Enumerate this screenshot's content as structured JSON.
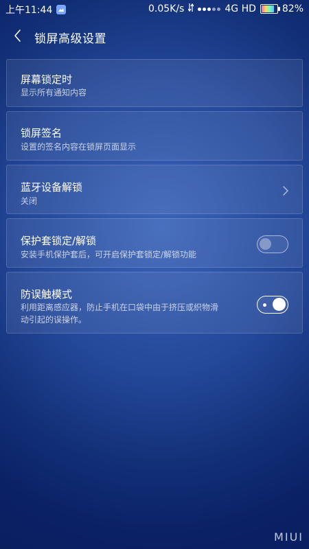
{
  "status_bar": {
    "time": "上午11:44",
    "speed": "0.05K/s",
    "network": "4G HD",
    "battery": "82%",
    "battery_level": 0.82
  },
  "header": {
    "title": "锁屏高级设置",
    "back_icon": "chevron-left-icon"
  },
  "settings": [
    {
      "title": "屏幕锁定时",
      "subtitle": "显示所有通知内容"
    },
    {
      "title": "锁屏签名",
      "subtitle": "设置的签名内容在锁屏页面显示"
    },
    {
      "title": "蓝牙设备解锁",
      "subtitle": "关闭",
      "accessory": "chevron-right-icon"
    },
    {
      "title": "保护套锁定/解锁",
      "subtitle": "安装手机保护套后，可开启保护套锁定/解锁功能",
      "toggle": "off"
    },
    {
      "title": "防误触模式",
      "subtitle_line1": "利用距离感应器，防止手机在口袋中由于挤压或织物滑",
      "subtitle_line2": "动引起的误操作。",
      "toggle": "on"
    }
  ],
  "watermark": "MIUI"
}
